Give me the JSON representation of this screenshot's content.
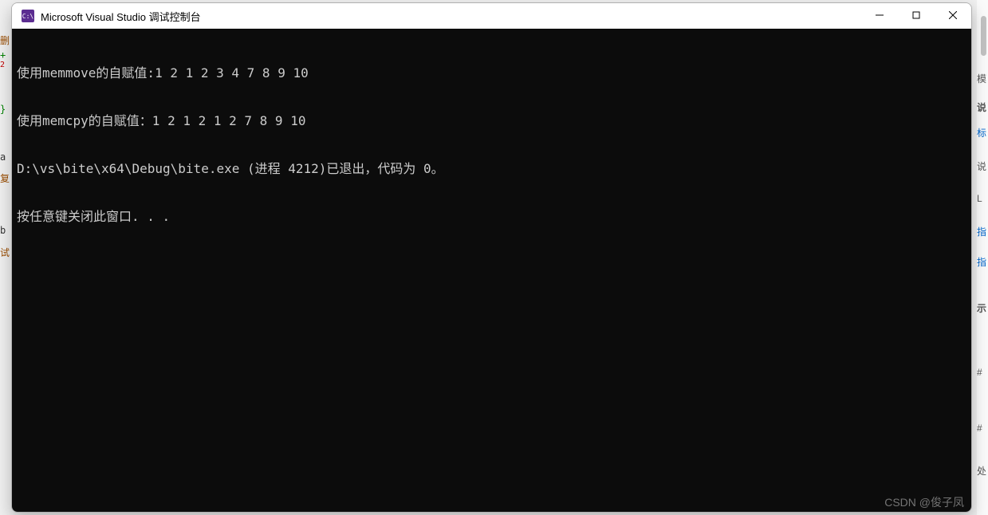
{
  "window": {
    "title": "Microsoft Visual Studio 调试控制台",
    "app_icon_text": "C:\\"
  },
  "console": {
    "lines": [
      "使用memmove的自赋值:1 2 1 2 3 4 7 8 9 10",
      "使用memcpy的自赋值：1 2 1 2 1 2 7 8 9 10",
      "D:\\vs\\bite\\x64\\Debug\\bite.exe (进程 4212)已退出，代码为 0。",
      "按任意键关闭此窗口. . ."
    ]
  },
  "background": {
    "markers": {
      "m0": "删",
      "m1": "+",
      "m2": "2",
      "m3": "}",
      "m4": "a",
      "m5": "复",
      "m6": "b",
      "m7": "试"
    },
    "right": {
      "r0": "模",
      "r1": "说",
      "r2": "标",
      "r3": "说",
      "r4": "L",
      "r5": "指",
      "r6": "指",
      "r7": "示",
      "r8": "#",
      "r9": "#",
      "r10": "处"
    }
  },
  "watermark": "CSDN @俊子凤"
}
